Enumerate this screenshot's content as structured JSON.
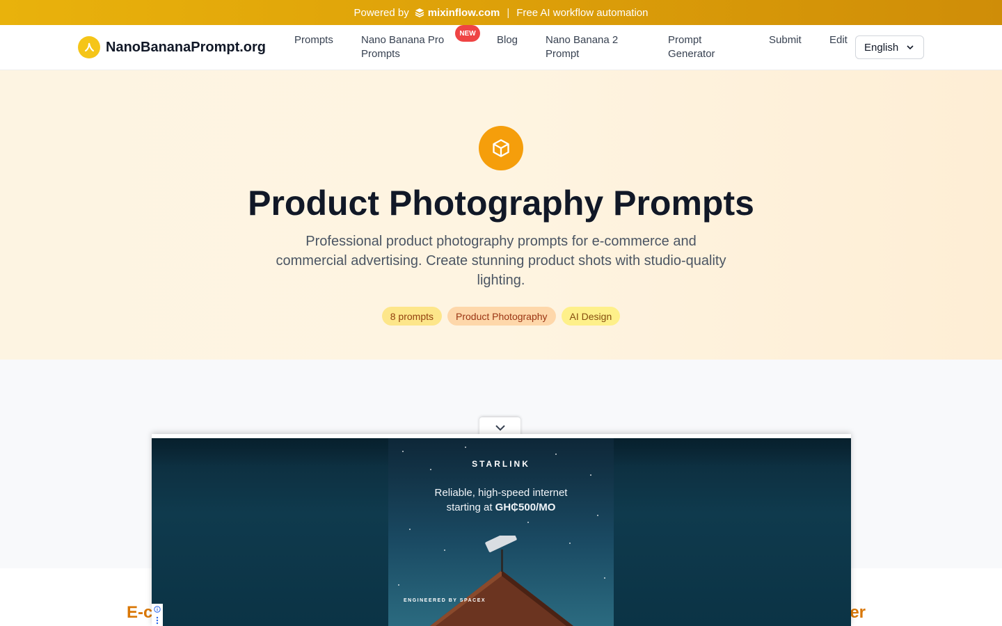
{
  "banner": {
    "powered_by": "Powered by",
    "brand": "mixinflow.com",
    "separator": "|",
    "tagline": "Free AI workflow automation",
    "brand_icon": "layers-icon"
  },
  "nav": {
    "logo_text": "NanoBananaPrompt.org",
    "logo_icon": "banana-icon",
    "links": {
      "prompts": "Prompts",
      "pro_line1": "Nano Banana Pro",
      "pro_line2": "Prompts",
      "blog": "Blog",
      "nb2_line1": "Nano Banana 2",
      "nb2_line2": "Prompt",
      "gen_line1": "Prompt",
      "gen_line2": "Generator",
      "submit": "Submit",
      "edit": "Edit"
    },
    "new_badge": "NEW",
    "language": "English",
    "language_icon": "chevron-down-icon"
  },
  "hero": {
    "icon": "cube-icon",
    "title": "Product Photography Prompts",
    "description": "Professional product photography prompts for e-commerce and commercial advertising. Create stunning product shots with studio-quality lighting.",
    "tags": [
      "8 prompts",
      "Product Photography",
      "AI Design"
    ]
  },
  "sections": {
    "left_heading_visible": "E-c",
    "right_heading_visible": "er"
  },
  "ad": {
    "brand": "STARLINK",
    "headline_line1": "Reliable, high-speed internet",
    "headline_line2_prefix": "starting at",
    "price": "GH₵500/MO",
    "engineered_by": "ENGINEERED BY SPACEX",
    "toggle_icon": "chevron-down-icon",
    "info_icon": "info-icon"
  },
  "colors": {
    "banner_gold": "#dda009",
    "accent_orange": "#f59e0b",
    "badge_red": "#ef4444",
    "heading_orange": "#d97706"
  }
}
